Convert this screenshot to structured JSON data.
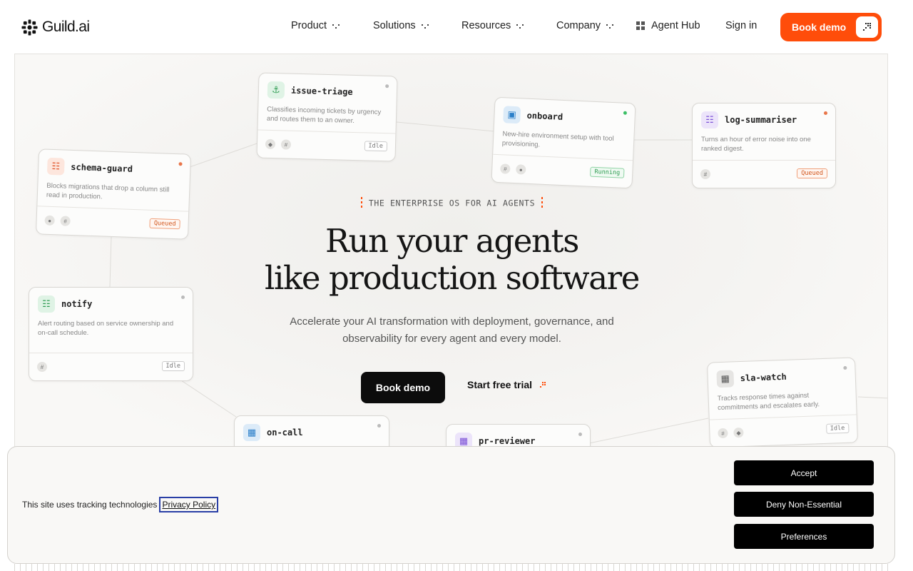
{
  "header": {
    "logo_text": "Guild.ai",
    "nav": [
      {
        "label": "Product"
      },
      {
        "label": "Solutions"
      },
      {
        "label": "Resources"
      },
      {
        "label": "Company"
      }
    ],
    "agent_hub_label": "Agent Hub",
    "sign_in_label": "Sign in",
    "book_demo_label": "Book demo",
    "accent_color": "#ff4d0a"
  },
  "hero": {
    "eyebrow": "THE ENTERPRISE OS FOR AI AGENTS",
    "title_line1": "Run your agents",
    "title_line2": "like production software",
    "subtitle": "Accelerate your AI transformation with deployment, governance, and observability for every agent and every model.",
    "cta_primary": "Book demo",
    "cta_secondary": "Start free trial"
  },
  "agents": [
    {
      "name": "schema-guard",
      "desc": "Blocks migrations that drop a column still read in production.",
      "status": "Queued",
      "icon": "robot-icon",
      "icon_color": "#e0542a",
      "dot_color": "#e8764a"
    },
    {
      "name": "issue-triage",
      "desc": "Classifies incoming tickets by urgency and routes them to an owner.",
      "status": "Idle",
      "icon": "anchor-icon",
      "icon_color": "#2f9c52",
      "dot_color": "#bbbbbb"
    },
    {
      "name": "onboard",
      "desc": "New-hire environment setup with tool provisioning.",
      "status": "Running",
      "icon": "whale-icon",
      "icon_color": "#2b7fc9",
      "dot_color": "#3cbf66"
    },
    {
      "name": "log-summariser",
      "desc": "Turns an hour of error noise into one ranked digest.",
      "status": "Queued",
      "icon": "robot-icon",
      "icon_color": "#7a4fd6",
      "dot_color": "#e8764a"
    },
    {
      "name": "notify",
      "desc": "Alert routing based on service ownership and on-call schedule.",
      "status": "Idle",
      "icon": "robot-icon",
      "icon_color": "#2f9c52",
      "dot_color": "#bbbbbb"
    },
    {
      "name": "sla-watch",
      "desc": "Tracks response times against commitments and escalates early.",
      "status": "Idle",
      "icon": "ghost-icon",
      "icon_color": "#555555",
      "dot_color": "#bbbbbb"
    },
    {
      "name": "on-call",
      "desc": "",
      "status": "",
      "icon": "ghost-icon",
      "icon_color": "#2b7fc9",
      "dot_color": "#bbbbbb"
    },
    {
      "name": "pr-reviewer",
      "desc": "",
      "status": "",
      "icon": "ghost-icon",
      "icon_color": "#7a4fd6",
      "dot_color": "#bbbbbb"
    }
  ],
  "cookie": {
    "text": "This site uses tracking technologies",
    "link": "Privacy Policy",
    "accept": "Accept",
    "deny": "Deny Non-Essential",
    "preferences": "Preferences"
  }
}
